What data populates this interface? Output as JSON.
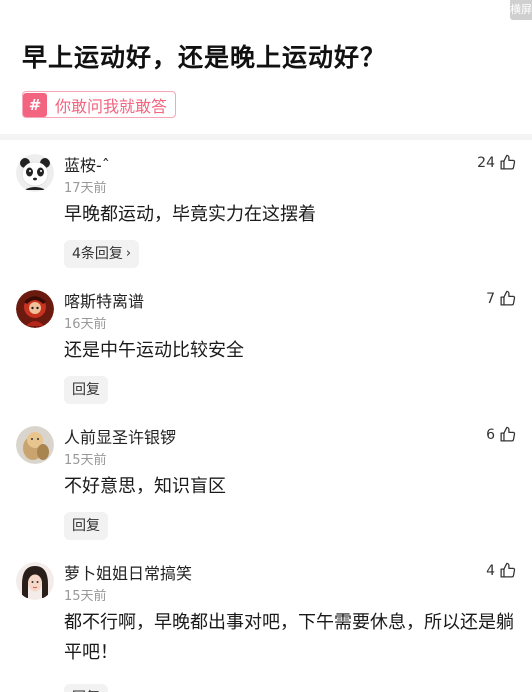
{
  "corner_badge": "横屏",
  "question": {
    "title": "早上运动好，还是晚上运动好？",
    "topic_tag": "你敢问我就敢答"
  },
  "comments": [
    {
      "username": "蓝桉-ˆ",
      "time": "17天前",
      "content": "早晚都运动，毕竟实力在这摆着",
      "likes": "24",
      "reply_label": "4条回复",
      "avatar": "panda-avatar"
    },
    {
      "username": "喀斯特离谱",
      "time": "16天前",
      "content": "还是中午运动比较安全",
      "likes": "7",
      "reply_label": "回复",
      "avatar": "red-character-avatar"
    },
    {
      "username": "人前显圣许银锣",
      "time": "15天前",
      "content": "不好意思，知识盲区",
      "likes": "6",
      "reply_label": "回复",
      "avatar": "doll-avatar"
    },
    {
      "username": "萝卜姐姐日常搞笑",
      "time": "15天前",
      "content": "都不行啊，早晚都出事对吧，下午需要休息，所以还是躺平吧！",
      "likes": "4",
      "reply_label": "回复",
      "avatar": "girl-avatar"
    }
  ]
}
